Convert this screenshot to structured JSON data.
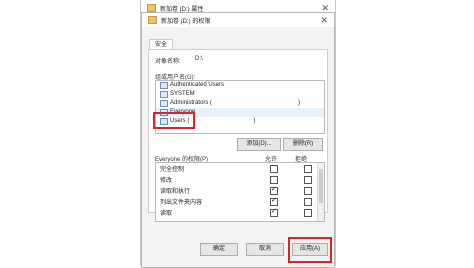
{
  "window_back": {
    "title": "新加卷 (D:) 属性"
  },
  "window_front": {
    "title": "新加卷 (D:) 的权限",
    "tab": "安全",
    "object_label": "对象名称:",
    "object_value": "D:\\",
    "group_label": "组或用户名(G):",
    "users": [
      {
        "name": "Authenticated Users"
      },
      {
        "name": "SYSTEM"
      },
      {
        "name": "Administrators ("
      },
      {
        "name": "Everyone"
      },
      {
        "name": "Users ("
      }
    ],
    "paren_close": ")",
    "add_button": "添加(D)...",
    "remove_button": "删除(R)",
    "perm_header": {
      "label": "Everyone 的权限(P)",
      "allow": "允许",
      "deny": "拒绝"
    },
    "permissions": [
      {
        "name": "完全控制",
        "allow": false,
        "deny": false
      },
      {
        "name": "修改",
        "allow": false,
        "deny": false
      },
      {
        "name": "读取和执行",
        "allow": true,
        "deny": false
      },
      {
        "name": "列出文件夹内容",
        "allow": true,
        "deny": false
      },
      {
        "name": "读取",
        "allow": true,
        "deny": false
      }
    ],
    "buttons": {
      "ok": "确定",
      "cancel": "取消",
      "apply": "应用(A)"
    }
  },
  "colors": {
    "highlight": "#d6262d",
    "selection": "#e5f1fb"
  }
}
